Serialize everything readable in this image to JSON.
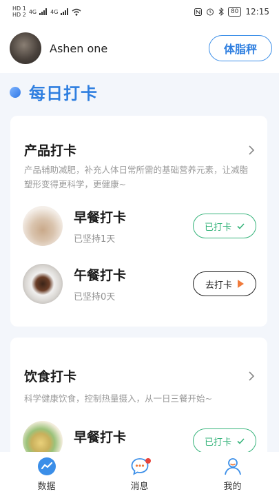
{
  "status_bar": {
    "sim1": "HD 1",
    "sim2": "HD 2",
    "net1": "4G",
    "net2": "4G",
    "battery": "80",
    "time": "12:15"
  },
  "header": {
    "username": "Ashen one",
    "scale_button": "体脂秤"
  },
  "section": {
    "title": "每日打卡"
  },
  "product_card": {
    "title": "产品打卡",
    "description": "产品辅助减肥，补充人体日常所需的基础营养元素，让减脂塑形变得更科学，更健康~",
    "items": [
      {
        "title": "早餐打卡",
        "subtitle": "已坚持1天",
        "button": "已打卡",
        "status": "done"
      },
      {
        "title": "午餐打卡",
        "subtitle": "已坚持0天",
        "button": "去打卡",
        "status": "pending"
      }
    ]
  },
  "diet_card": {
    "title": "饮食打卡",
    "description": "科学健康饮食，控制热量摄入，从一日三餐开始~",
    "items": [
      {
        "title": "早餐打卡",
        "button": "已打卡",
        "status": "done"
      }
    ]
  },
  "tabbar": {
    "items": [
      {
        "label": "数据",
        "icon": "chart-icon"
      },
      {
        "label": "消息",
        "icon": "message-icon",
        "badge": true
      },
      {
        "label": "我的",
        "icon": "profile-icon"
      }
    ]
  },
  "colors": {
    "accent": "#2f7fe0",
    "success": "#35b37a",
    "go_arrow": "#f07b3c"
  }
}
